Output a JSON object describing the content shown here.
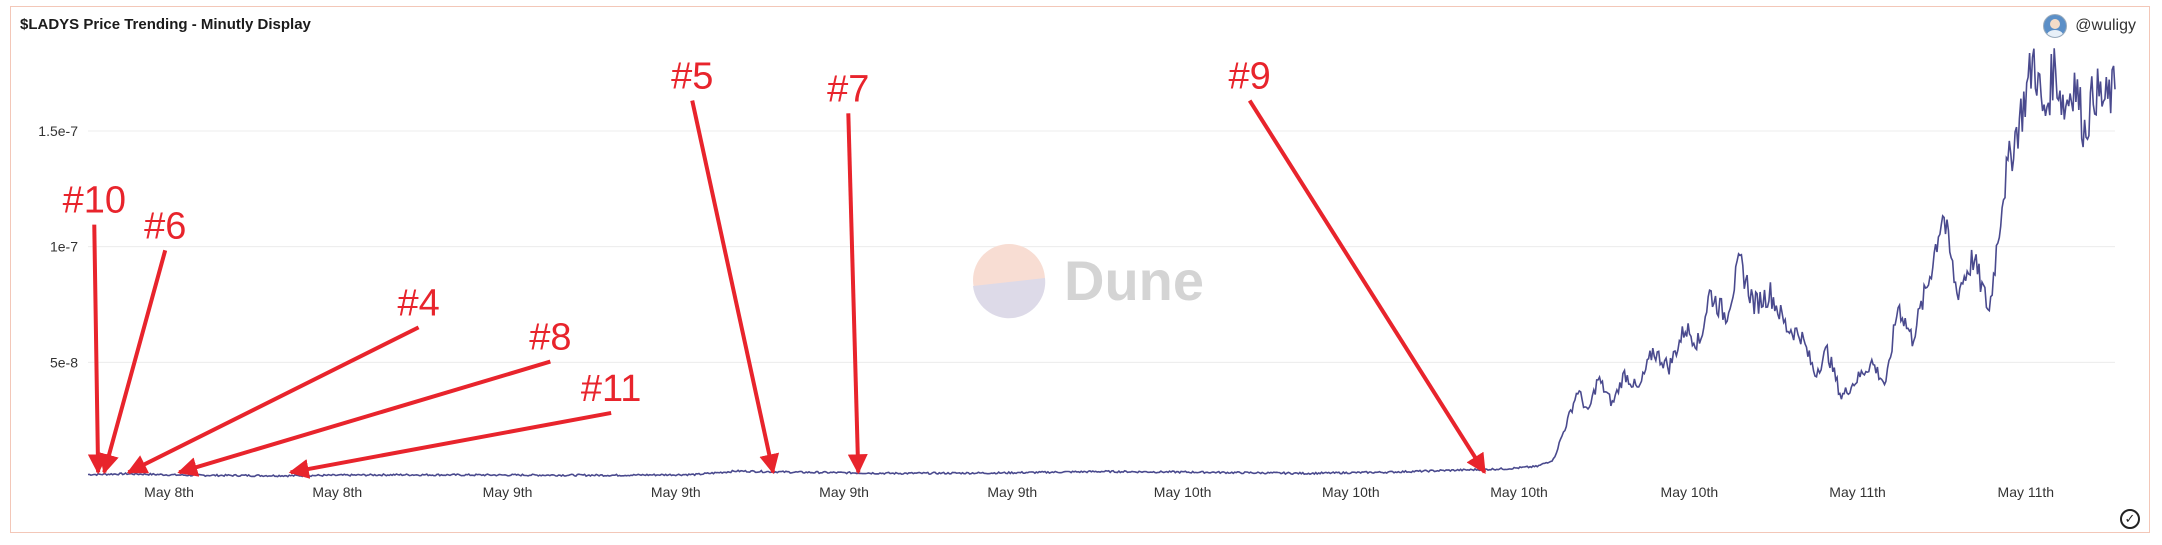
{
  "title": "$LADYS Price Trending - Minutly Display",
  "user": {
    "handle": "@wuligy"
  },
  "watermark": "Dune",
  "colors": {
    "line": "#4a4a8e",
    "annotation": "#e8242c",
    "grid": "#ececec"
  },
  "chart_data": {
    "type": "line",
    "title": "$LADYS Price Trending - Minutly Display",
    "xlabel": "",
    "ylabel": "",
    "ylim": [
      0,
      1.85e-07
    ],
    "yticks": [
      {
        "value": 5e-08,
        "label": "5e-8"
      },
      {
        "value": 1e-07,
        "label": "1e-7"
      },
      {
        "value": 1.5e-07,
        "label": "1.5e-7"
      }
    ],
    "xlim": [
      0,
      1.0
    ],
    "xticks": [
      {
        "pos": 0.04,
        "label": "May 8th"
      },
      {
        "pos": 0.123,
        "label": "May 8th"
      },
      {
        "pos": 0.207,
        "label": "May 9th"
      },
      {
        "pos": 0.29,
        "label": "May 9th"
      },
      {
        "pos": 0.373,
        "label": "May 9th"
      },
      {
        "pos": 0.456,
        "label": "May 9th"
      },
      {
        "pos": 0.54,
        "label": "May 10th"
      },
      {
        "pos": 0.623,
        "label": "May 10th"
      },
      {
        "pos": 0.706,
        "label": "May 10th"
      },
      {
        "pos": 0.79,
        "label": "May 10th"
      },
      {
        "pos": 0.873,
        "label": "May 11th"
      },
      {
        "pos": 0.956,
        "label": "May 11th"
      }
    ],
    "series": [
      {
        "x": [
          0.0,
          0.02,
          0.05,
          0.1,
          0.15,
          0.2,
          0.26,
          0.3,
          0.32,
          0.35,
          0.4,
          0.45,
          0.5,
          0.55,
          0.6,
          0.64,
          0.66,
          0.68,
          0.7,
          0.715,
          0.723,
          0.73,
          0.735,
          0.74,
          0.745,
          0.752,
          0.758,
          0.765,
          0.772,
          0.78,
          0.788,
          0.795,
          0.8,
          0.808,
          0.815,
          0.822,
          0.83,
          0.838,
          0.845,
          0.852,
          0.858,
          0.865,
          0.872,
          0.88,
          0.887,
          0.893,
          0.9,
          0.908,
          0.915,
          0.922,
          0.93,
          0.938,
          0.945,
          0.95,
          0.955,
          0.96,
          0.965,
          0.97,
          0.975,
          0.98,
          0.985,
          0.99,
          0.995,
          1.0
        ],
        "y": [
          1.5e-09,
          1.8e-09,
          1.2e-09,
          1e-09,
          1.4e-09,
          1.3e-09,
          1.2e-09,
          1.5e-09,
          3e-09,
          2.5e-09,
          2e-09,
          2.2e-09,
          2.8e-09,
          2.5e-09,
          2e-09,
          2.5e-09,
          3e-09,
          3.5e-09,
          4e-09,
          5e-09,
          8e-09,
          2.5e-08,
          3.8e-08,
          2.8e-08,
          4.3e-08,
          3.2e-08,
          4.5e-08,
          3.8e-08,
          5.5e-08,
          4.8e-08,
          6.5e-08,
          5.8e-08,
          8e-08,
          7e-08,
          9.3e-08,
          7.5e-08,
          8e-08,
          6.5e-08,
          6.2e-08,
          4.5e-08,
          5.5e-08,
          3.5e-08,
          4.2e-08,
          5e-08,
          4e-08,
          7.5e-08,
          6e-08,
          8.5e-08,
          1.15e-07,
          8e-08,
          9.5e-08,
          7.2e-08,
          1.25e-07,
          1.45e-07,
          1.62e-07,
          1.82e-07,
          1.55e-07,
          1.78e-07,
          1.6e-07,
          1.72e-07,
          1.5e-07,
          1.68e-07,
          1.62e-07,
          1.68e-07
        ]
      }
    ]
  },
  "annotations": [
    {
      "label": "#10",
      "text_x": 0.01,
      "text_y": 0.62,
      "tip_x": 0.005,
      "tip_y": 0.004
    },
    {
      "label": "#6",
      "text_x": 0.045,
      "text_y": 0.56,
      "tip_x": 0.008,
      "tip_y": 0.004
    },
    {
      "label": "#4",
      "text_x": 0.17,
      "text_y": 0.38,
      "tip_x": 0.02,
      "tip_y": 0.004
    },
    {
      "label": "#8",
      "text_x": 0.235,
      "text_y": 0.3,
      "tip_x": 0.045,
      "tip_y": 0.004
    },
    {
      "label": "#11",
      "text_x": 0.265,
      "text_y": 0.18,
      "tip_x": 0.1,
      "tip_y": 0.004
    },
    {
      "label": "#5",
      "text_x": 0.305,
      "text_y": 0.91,
      "tip_x": 0.338,
      "tip_y": 0.004
    },
    {
      "label": "#7",
      "text_x": 0.382,
      "text_y": 0.88,
      "tip_x": 0.38,
      "tip_y": 0.004
    },
    {
      "label": "#9",
      "text_x": 0.58,
      "text_y": 0.91,
      "tip_x": 0.689,
      "tip_y": 0.004
    }
  ]
}
